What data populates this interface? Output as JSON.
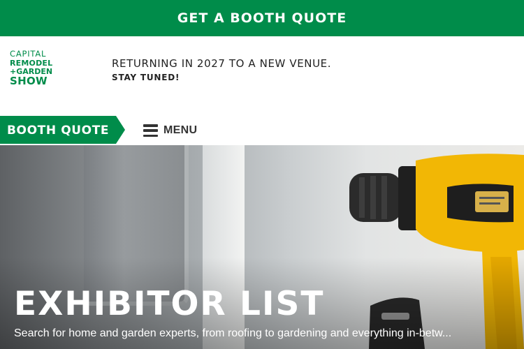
{
  "top_banner": {
    "label": "GET A BOOTH QUOTE"
  },
  "logo": {
    "line1": "CAPITAL",
    "line2": "REMODEL",
    "line3": "+GARDEN",
    "line4": "SHOW"
  },
  "announcement": {
    "main": "RETURNING IN 2027 TO A NEW VENUE.",
    "sub": "STAY TUNED!"
  },
  "nav": {
    "booth_quote_label": "BOOTH QUOTE",
    "menu_label": "MENU",
    "menu_icon": "hamburger-icon"
  },
  "hero": {
    "title": "EXHIBITOR LIST",
    "subtitle": "Search for home and garden experts, from roofing to gardening and everything in-betw..."
  },
  "colors": {
    "brand_green": "#008c4a",
    "drill_yellow": "#f2b705",
    "text_dark": "#222222"
  }
}
